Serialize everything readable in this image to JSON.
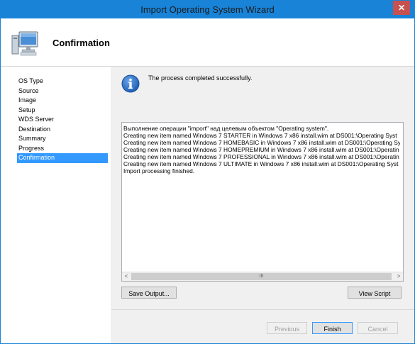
{
  "window": {
    "title": "Import Operating System Wizard",
    "close_glyph": "✕"
  },
  "header": {
    "title": "Confirmation",
    "icon": "computer-icon"
  },
  "sidebar": {
    "items": [
      {
        "label": "OS Type"
      },
      {
        "label": "Source"
      },
      {
        "label": "Image"
      },
      {
        "label": "Setup"
      },
      {
        "label": "WDS Server"
      },
      {
        "label": "Destination"
      },
      {
        "label": "Summary"
      },
      {
        "label": "Progress"
      },
      {
        "label": "Confirmation",
        "active": true
      }
    ]
  },
  "main": {
    "status_icon": "info-icon",
    "message": "The process completed successfully.",
    "output_lines": [
      "Выполнение операции \"import\" над целевым объектом \"Operating system\".",
      "Creating new item named Windows 7 STARTER in Windows 7 x86 install.wim at DS001:\\Operating Syst",
      "Creating new item named Windows 7 HOMEBASIC in Windows 7 x86 install.wim at DS001:\\Operating Sy",
      "Creating new item named Windows 7 HOMEPREMIUM in Windows 7 x86 install.wim at DS001:\\Operatin",
      "Creating new item named Windows 7 PROFESSIONAL in Windows 7 x86 install.wim at DS001:\\Operatin",
      "Creating new item named Windows 7 ULTIMATE in Windows 7 x86 install.wim at DS001:\\Operating Syst",
      "Import processing finished."
    ],
    "scrollbar": {
      "left_arrow": "<",
      "right_arrow": ">",
      "thumb_grip": "III"
    },
    "save_output_label": "Save Output...",
    "view_script_label": "View Script"
  },
  "footer": {
    "previous_label": "Previous",
    "finish_label": "Finish",
    "cancel_label": "Cancel"
  },
  "colors": {
    "titlebar": "#1883d7",
    "selection": "#3399ff",
    "close": "#c75050"
  }
}
